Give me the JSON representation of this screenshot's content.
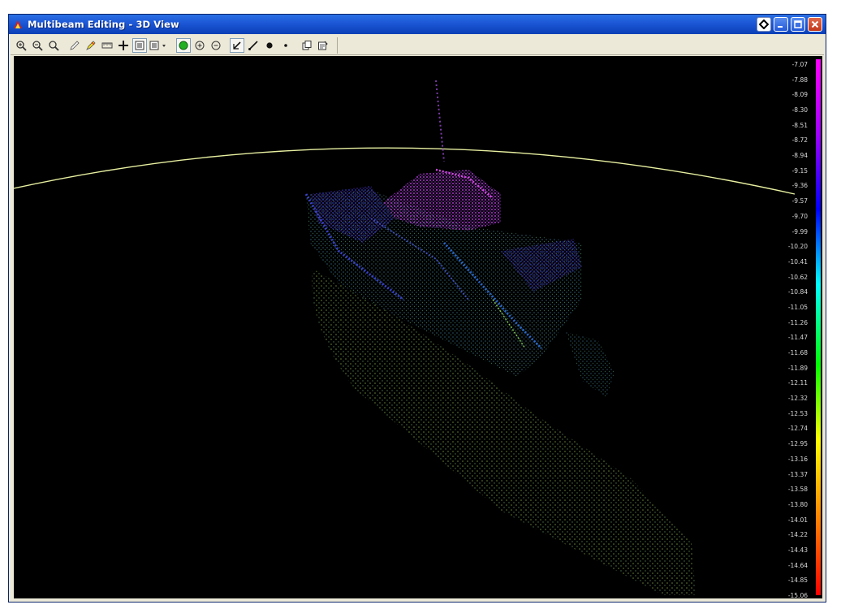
{
  "window": {
    "title": "Multibeam Editing - 3D View"
  },
  "toolbar": {
    "tools": [
      {
        "name": "zoom-in-icon"
      },
      {
        "name": "zoom-out-icon"
      },
      {
        "name": "zoom-extents-icon"
      },
      {
        "name": "pencil-icon"
      },
      {
        "name": "highlighter-icon"
      },
      {
        "name": "ruler-icon"
      },
      {
        "name": "crosshair-icon"
      },
      {
        "name": "panel-icon"
      },
      {
        "name": "panel-dropdown-icon"
      },
      {
        "name": "green-dot-icon"
      },
      {
        "name": "add-circle-icon"
      },
      {
        "name": "remove-circle-icon"
      },
      {
        "name": "select-arrow-icon"
      },
      {
        "name": "line-tool-icon"
      },
      {
        "name": "large-dot-icon"
      },
      {
        "name": "small-dot-icon"
      },
      {
        "name": "copy-icon"
      },
      {
        "name": "properties-icon"
      }
    ]
  },
  "depth_scale": {
    "labels": [
      "-7.07",
      "-7.88",
      "-8.09",
      "-8.30",
      "-8.51",
      "-8.72",
      "-8.94",
      "-9.15",
      "-9.36",
      "-9.57",
      "-9.70",
      "-9.99",
      "-10.20",
      "-10.41",
      "-10.62",
      "-10.84",
      "-11.05",
      "-11.26",
      "-11.47",
      "-11.68",
      "-11.89",
      "-12.11",
      "-12.32",
      "-12.53",
      "-12.74",
      "-12.95",
      "-13.16",
      "-13.37",
      "-13.58",
      "-13.80",
      "-14.01",
      "-14.22",
      "-14.43",
      "-14.64",
      "-14.85",
      "-15.06"
    ],
    "colors": [
      "#ff00ff",
      "#a000ff",
      "#0000ff",
      "#00ffff",
      "#00ff00",
      "#ffff00",
      "#ff8000",
      "#ff0000"
    ]
  },
  "colors": {
    "title_bar": "#1c56d6",
    "background": "#000000",
    "horizon_line": "#e8f0a0"
  }
}
